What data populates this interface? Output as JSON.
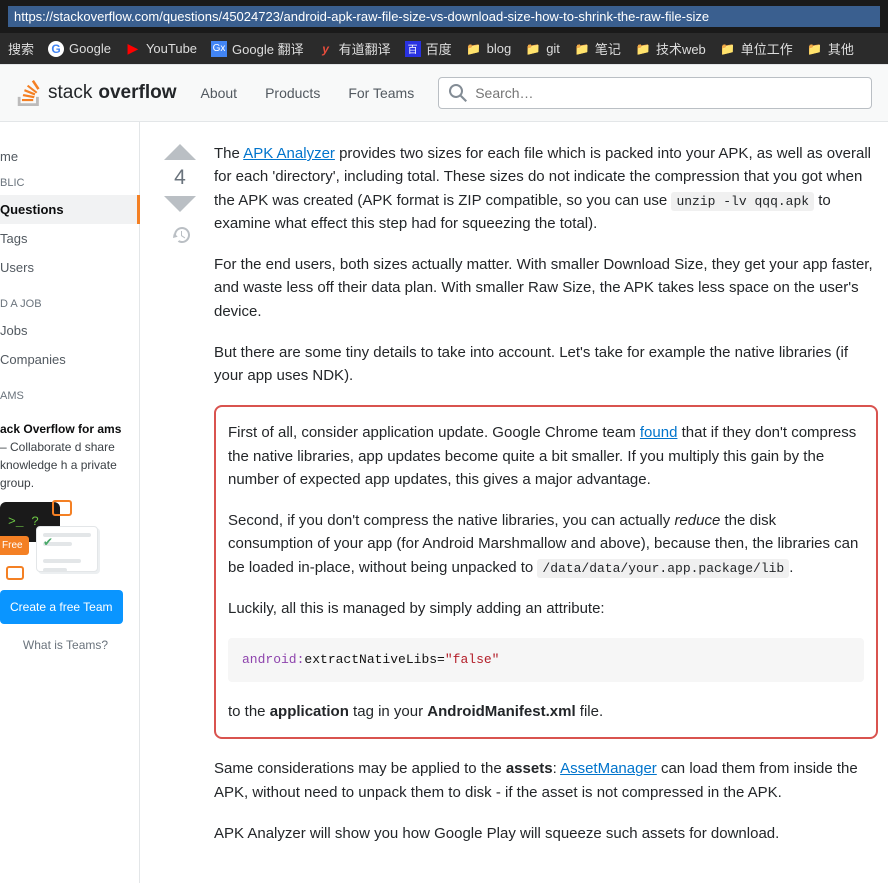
{
  "url": "https://stackoverflow.com/questions/45024723/android-apk-raw-file-size-vs-download-size-how-to-shrink-the-raw-file-size",
  "bookmarks": [
    {
      "label": "搜索",
      "icon": "folder"
    },
    {
      "label": "Google",
      "icon": "google"
    },
    {
      "label": "YouTube",
      "icon": "youtube"
    },
    {
      "label": "Google 翻译",
      "icon": "gtrans"
    },
    {
      "label": "有道翻译",
      "icon": "youdao"
    },
    {
      "label": "百度",
      "icon": "baidu"
    },
    {
      "label": "blog",
      "icon": "folder"
    },
    {
      "label": "git",
      "icon": "folder"
    },
    {
      "label": "笔记",
      "icon": "folder"
    },
    {
      "label": "技术web",
      "icon": "folder"
    },
    {
      "label": "单位工作",
      "icon": "folder"
    },
    {
      "label": "其他",
      "icon": "folder"
    }
  ],
  "header": {
    "logo_thin": "stack",
    "logo_bold": "overflow",
    "nav": [
      "About",
      "Products",
      "For Teams"
    ],
    "search_placeholder": "Search…"
  },
  "sidebar": {
    "home": "me",
    "hdr_public": "BLIC",
    "questions": "Questions",
    "tags": "Tags",
    "users": "Users",
    "hdr_job": "D A JOB",
    "jobs": "Jobs",
    "companies": "Companies",
    "hdr_teams": "AMS",
    "teams_title": "ack Overflow for ams",
    "teams_desc": " – Collaborate d share knowledge h a private group.",
    "terminal_prompt": ">_ ?",
    "free_tag": "Free",
    "cta": "Create a free Team",
    "teams_link": "What is Teams?"
  },
  "vote": {
    "score": "4"
  },
  "post": {
    "p1a": "The ",
    "p1_link": "APK Analyzer",
    "p1b": " provides two sizes for each file which is packed into your APK, as well as overall for each 'directory', including total. These sizes do not indicate the compression that you got when the APK was created (APK format is ZIP compatible, so you can use ",
    "p1_code": "unzip -lv qqq.apk",
    "p1c": " to examine what effect this step had for squeezing the total).",
    "p2": "For the end users, both sizes actually matter. With smaller Download Size, they get your app faster, and waste less off their data plan. With smaller Raw Size, the APK takes less space on the user's device.",
    "p3": "But there are some tiny details to take into account. Let's take for example the native libraries (if your app uses NDK).",
    "h1a": "First of all, consider application update. Google Chrome team ",
    "h1_link": "found",
    "h1b": " that if they don't compress the native libraries, app updates become quite a bit smaller. If you multiply this gain by the number of expected app updates, this gives a major advantage.",
    "h2a": "Second, if you don't compress the native libraries, you can actually ",
    "h2_em": "reduce",
    "h2b": " the disk consumption of your app (for Android Marshmallow and above), because then, the libraries can be loaded in-place, without being unpacked to ",
    "h2_code": "/data/data/your.app.package/lib",
    "h2c": ".",
    "h3": "Luckily, all this is managed by simply adding an attribute:",
    "code_k1": "android:",
    "code_k2": "extractNativeLibs=",
    "code_str": "\"false\"",
    "h4a": "to the ",
    "h4_b1": "application",
    "h4b": " tag in your ",
    "h4_b2": "AndroidManifest.xml",
    "h4c": " file.",
    "p5a": "Same considerations may be applied to the ",
    "p5_b": "assets",
    "p5b": ": ",
    "p5_link": "AssetManager",
    "p5c": " can load them from inside the APK, without need to unpack them to disk - if the asset is not compressed in the APK.",
    "p6": "APK Analyzer will show you how Google Play will squeeze such assets for download."
  }
}
